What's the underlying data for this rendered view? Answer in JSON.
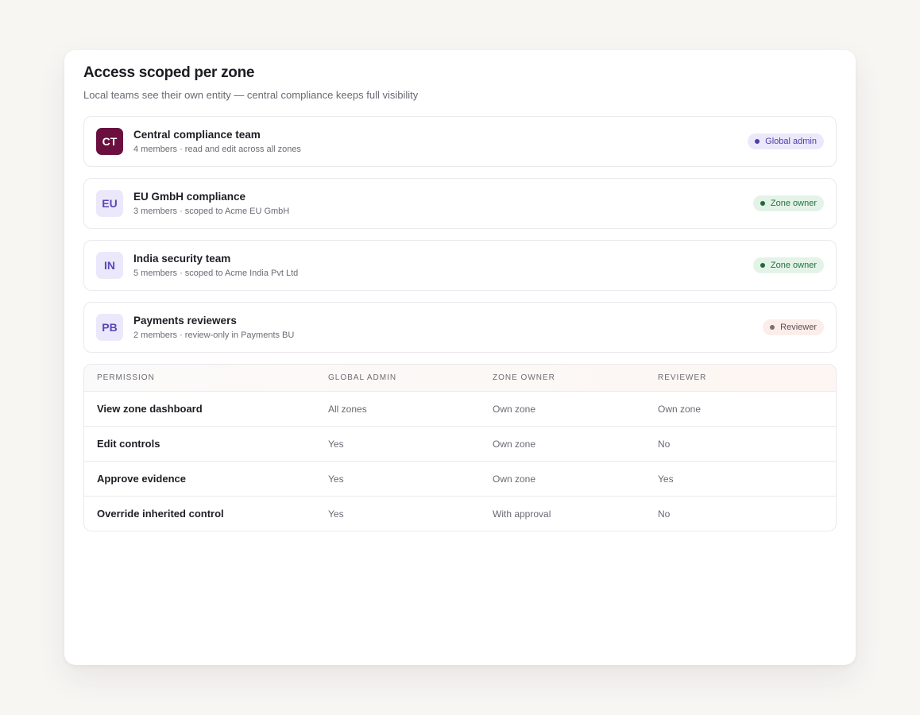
{
  "header": {
    "title": "Access scoped per zone",
    "subtitle": "Local teams see their own entity — central compliance keeps full visibility"
  },
  "teams": [
    {
      "initials": "CT",
      "name": "Central compliance team",
      "meta": "4 members · read and edit across all zones",
      "role": "Global admin"
    },
    {
      "initials": "EU",
      "name": "EU GmbH compliance",
      "meta": "3 members · scoped to Acme EU GmbH",
      "role": "Zone owner"
    },
    {
      "initials": "IN",
      "name": "India security team",
      "meta": "5 members · scoped to Acme India Pvt Ltd",
      "role": "Zone owner"
    },
    {
      "initials": "PB",
      "name": "Payments reviewers",
      "meta": "2 members · review-only in Payments BU",
      "role": "Reviewer"
    }
  ],
  "permissions": {
    "columns": [
      "Permission",
      "Global admin",
      "Zone owner",
      "Reviewer"
    ],
    "rows": [
      [
        "View zone dashboard",
        "All zones",
        "Own zone",
        "Own zone"
      ],
      [
        "Edit controls",
        "Yes",
        "Own zone",
        "No"
      ],
      [
        "Approve evidence",
        "Yes",
        "Own zone",
        "Yes"
      ],
      [
        "Override inherited control",
        "Yes",
        "With approval",
        "No"
      ]
    ]
  },
  "colors": {
    "page_bg": "#f7f6f3",
    "central_avatar": "#6b0f3f",
    "admin_badge": "#4d3ea8",
    "owner_badge": "#25703f",
    "reviewer_badge": "#7a6f74"
  }
}
